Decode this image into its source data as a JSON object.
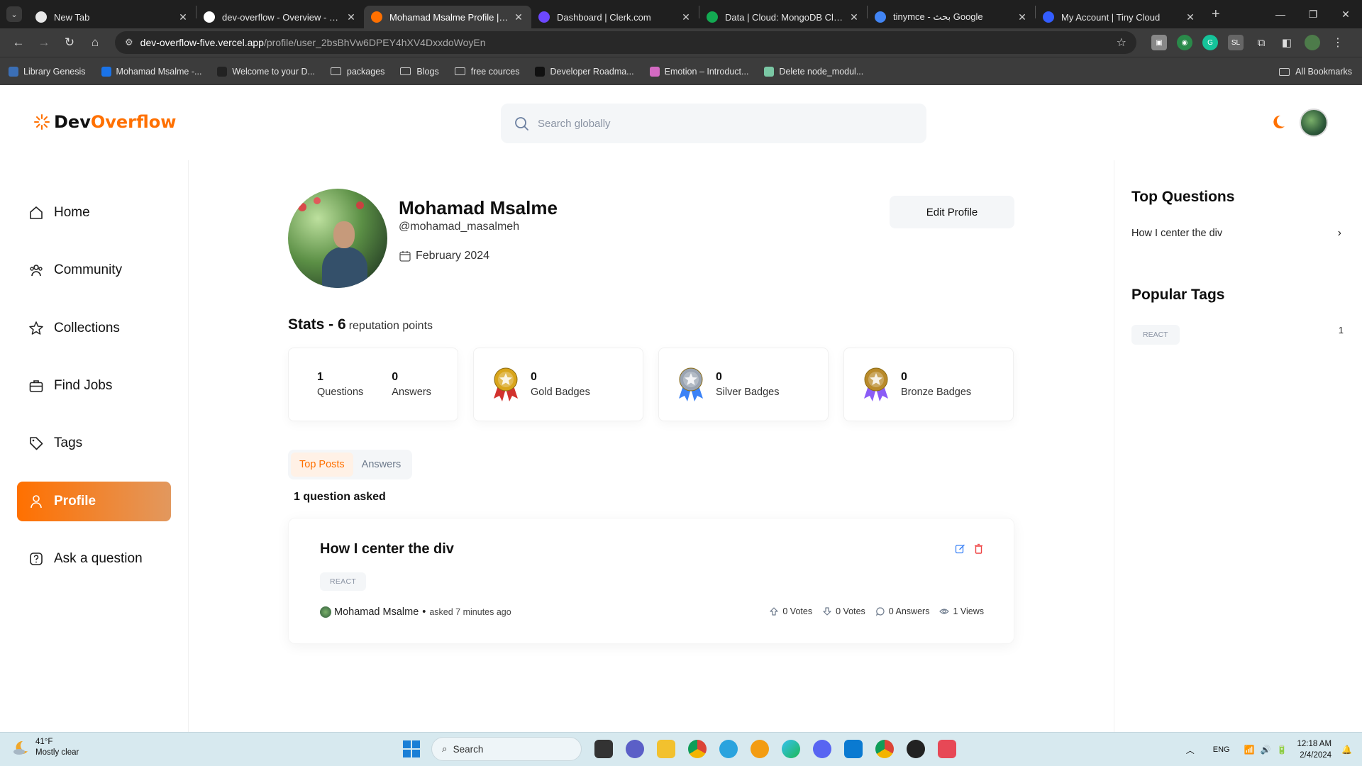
{
  "browser": {
    "tabs": [
      {
        "title": "New Tab",
        "active": false,
        "color": "#e8e8e8"
      },
      {
        "title": "dev-overflow - Overview - Verc",
        "active": false,
        "color": "#ffffff"
      },
      {
        "title": "Mohamad Msalme Profile | Dev",
        "active": true,
        "color": "#ff7000"
      },
      {
        "title": "Dashboard | Clerk.com",
        "active": false,
        "color": "#6c47ff"
      },
      {
        "title": "Data | Cloud: MongoDB Cloud",
        "active": false,
        "color": "#13aa52"
      },
      {
        "title": "tinymce - بحث Google",
        "active": false,
        "color": "#4285f4"
      },
      {
        "title": "My Account | Tiny Cloud",
        "active": false,
        "color": "#335dff"
      }
    ],
    "url_host": "dev-overflow-five.vercel.app",
    "url_path": "/profile/user_2bsBhVw6DPEY4hXV4DxxdoWoyEn",
    "bookmarks": [
      {
        "label": "Library Genesis",
        "type": "site",
        "color": "#3b6fb6"
      },
      {
        "label": "Mohamad Msalme -...",
        "type": "site",
        "color": "#1a73e8"
      },
      {
        "label": "Welcome to your D...",
        "type": "site",
        "color": "#222222"
      },
      {
        "label": "packages",
        "type": "folder"
      },
      {
        "label": "Blogs",
        "type": "folder"
      },
      {
        "label": "free cources",
        "type": "folder"
      },
      {
        "label": "Developer Roadma...",
        "type": "site",
        "color": "#111111"
      },
      {
        "label": "Emotion – Introduct...",
        "type": "site",
        "color": "#d36ac2"
      },
      {
        "label": "Delete node_modul...",
        "type": "site",
        "color": "#7ac7a4"
      }
    ],
    "all_bookmarks": "All Bookmarks"
  },
  "header": {
    "logo_dev": "Dev",
    "logo_overflow": "Overflow",
    "search_placeholder": "Search globally"
  },
  "sidebar": {
    "items": [
      {
        "label": "Home",
        "icon": "home-icon",
        "active": false
      },
      {
        "label": "Community",
        "icon": "users-icon",
        "active": false
      },
      {
        "label": "Collections",
        "icon": "star-icon",
        "active": false
      },
      {
        "label": "Find Jobs",
        "icon": "briefcase-icon",
        "active": false
      },
      {
        "label": "Tags",
        "icon": "tag-icon",
        "active": false
      },
      {
        "label": "Profile",
        "icon": "user-icon",
        "active": true
      },
      {
        "label": "Ask a question",
        "icon": "question-icon",
        "active": false
      }
    ]
  },
  "profile": {
    "name": "Mohamad Msalme",
    "handle": "@mohamad_masalmeh",
    "joined": "February 2024",
    "edit_label": "Edit Profile"
  },
  "stats": {
    "title": "Stats - 6",
    "reputation_label": "reputation points",
    "questions": "1",
    "questions_label": "Questions",
    "answers": "0",
    "answers_label": "Answers",
    "badges": [
      {
        "count": "0",
        "label": "Gold Badges",
        "medal": "gold-medal-icon",
        "color": "#d9a51b"
      },
      {
        "count": "0",
        "label": "Silver Badges",
        "medal": "silver-medal-icon",
        "color": "#9aa4b2"
      },
      {
        "count": "0",
        "label": "Bronze Badges",
        "medal": "bronze-medal-icon",
        "color": "#b98a2a"
      }
    ]
  },
  "tabs": {
    "top_posts": "Top Posts",
    "answers": "Answers"
  },
  "asked_summary": "1 question asked",
  "question": {
    "title": "How I center the div",
    "tag": "REACT",
    "author": "Mohamad Msalme",
    "asked": "asked 7 minutes ago",
    "upvotes": "0 Votes",
    "downvotes": "0 Votes",
    "answers": "0 Answers",
    "views": "1 Views"
  },
  "rightbar": {
    "top_questions_title": "Top Questions",
    "top_questions": [
      "How I center the div"
    ],
    "popular_tags_title": "Popular Tags",
    "tags": [
      {
        "name": "REACT",
        "count": "1"
      }
    ]
  },
  "taskbar": {
    "temp": "41°F",
    "weather": "Mostly clear",
    "search": "Search",
    "lang": "ENG",
    "time": "12:18 AM",
    "date": "2/4/2024"
  },
  "colors": {
    "accent": "#ff7000",
    "accent_gradient_end": "#e2985e"
  }
}
